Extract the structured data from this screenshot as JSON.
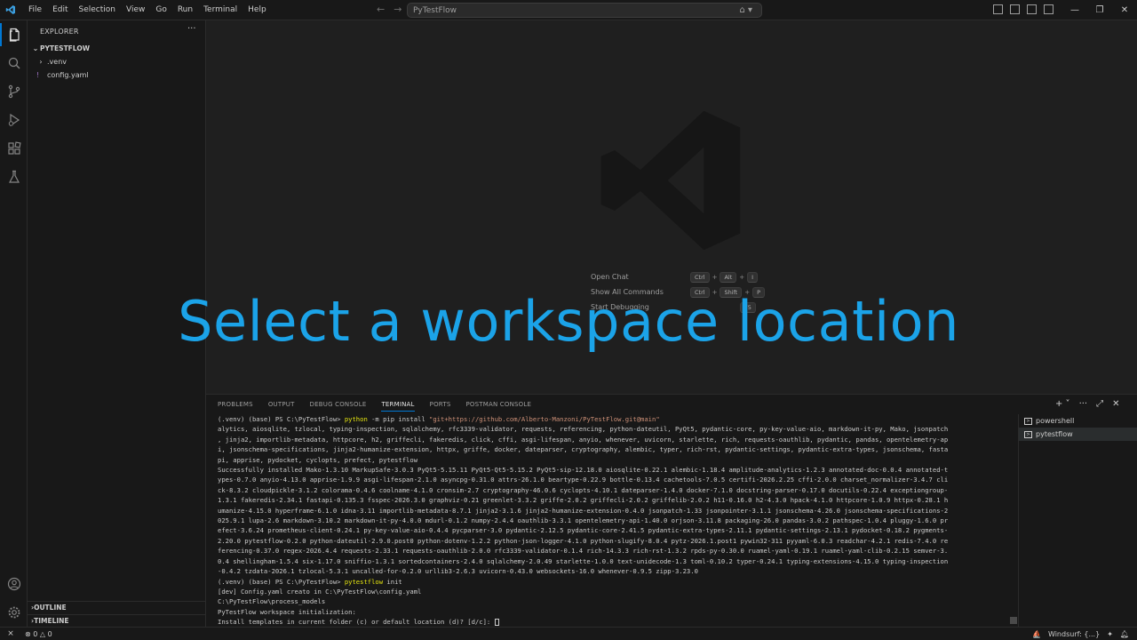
{
  "titlebar": {
    "menu": [
      "File",
      "Edit",
      "Selection",
      "View",
      "Go",
      "Run",
      "Terminal",
      "Help"
    ],
    "search_text": "PyTestFlow"
  },
  "sidebar": {
    "header": "EXPLORER",
    "root": "PYTESTFLOW",
    "items": [
      ".venv",
      "config.yaml"
    ],
    "outline": "OUTLINE",
    "timeline": "TIMELINE"
  },
  "editor": {
    "shortcuts": [
      {
        "label": "Open Chat",
        "keys": [
          "Ctrl",
          "Alt",
          "I"
        ]
      },
      {
        "label": "Show All Commands",
        "keys": [
          "Ctrl",
          "Shift",
          "P"
        ]
      },
      {
        "label": "Start Debugging",
        "keys": [
          "F5"
        ]
      }
    ]
  },
  "overlay_text": "Select a workspace location",
  "panel": {
    "tabs": [
      "PROBLEMS",
      "OUTPUT",
      "DEBUG CONSOLE",
      "TERMINAL",
      "PORTS",
      "POSTMAN CONSOLE"
    ],
    "active_tab": "TERMINAL",
    "terminal_instances": [
      "powershell",
      "pytestflow"
    ],
    "terminal_lines": [
      {
        "prompt": "(.venv) (base) PS C:\\PyTestFlow> ",
        "cmd": "python",
        "flag": " -m pip install ",
        "str": "\"git+https://github.com/Alberto-Manzoni/PyTestFlow.git@main\""
      },
      {
        "text": "alytics, aiosqlite, tzlocal, typing-inspection, sqlalchemy, rfc3339-validator, requests, referencing, python-dateutil, PyQt5, pydantic-core, py-key-value-aio, markdown-it-py, Mako, jsonpatch"
      },
      {
        "text": ", jinja2, importlib-metadata, httpcore, h2, griffecli, fakeredis, click, cffi, asgi-lifespan, anyio, whenever, uvicorn, starlette, rich, requests-oauthlib, pydantic, pandas, opentelemetry-ap"
      },
      {
        "text": "i, jsonschema-specifications, jinja2-humanize-extension, httpx, griffe, docker, dateparser, cryptography, alembic, typer, rich-rst, pydantic-settings, pydantic-extra-types, jsonschema, fasta"
      },
      {
        "text": "pi, apprise, pydocket, cyclopts, prefect, pytestflow"
      },
      {
        "text": "Successfully installed Mako-1.3.10 MarkupSafe-3.0.3 PyQt5-5.15.11 PyQt5-Qt5-5.15.2 PyQt5-sip-12.18.0 aiosqlite-0.22.1 alembic-1.18.4 amplitude-analytics-1.2.3 annotated-doc-0.0.4 annotated-t"
      },
      {
        "text": "ypes-0.7.0 anyio-4.13.0 apprise-1.9.9 asgi-lifespan-2.1.0 asyncpg-0.31.0 attrs-26.1.0 beartype-0.22.9 bottle-0.13.4 cachetools-7.0.5 certifi-2026.2.25 cffi-2.0.0 charset_normalizer-3.4.7 cli"
      },
      {
        "text": "ck-8.3.2 cloudpickle-3.1.2 colorama-0.4.6 coolname-4.1.0 cronsim-2.7 cryptography-46.0.6 cyclopts-4.10.1 dateparser-1.4.0 docker-7.1.0 docstring-parser-0.17.0 docutils-0.22.4 exceptiongroup-"
      },
      {
        "text": "1.3.1 fakeredis-2.34.1 fastapi-0.135.3 fsspec-2026.3.0 graphviz-0.21 greenlet-3.3.2 griffe-2.0.2 griffecli-2.0.2 griffelib-2.0.2 h11-0.16.0 h2-4.3.0 hpack-4.1.0 httpcore-1.0.9 httpx-0.28.1 h"
      },
      {
        "text": "umanize-4.15.0 hyperframe-6.1.0 idna-3.11 importlib-metadata-8.7.1 jinja2-3.1.6 jinja2-humanize-extension-0.4.0 jsonpatch-1.33 jsonpointer-3.1.1 jsonschema-4.26.0 jsonschema-specifications-2"
      },
      {
        "text": "025.9.1 lupa-2.6 markdown-3.10.2 markdown-it-py-4.0.0 mdurl-0.1.2 numpy-2.4.4 oauthlib-3.3.1 opentelemetry-api-1.40.0 orjson-3.11.8 packaging-26.0 pandas-3.0.2 pathspec-1.0.4 pluggy-1.6.0 pr"
      },
      {
        "text": "efect-3.6.24 prometheus-client-0.24.1 py-key-value-aio-0.4.4 pycparser-3.0 pydantic-2.12.5 pydantic-core-2.41.5 pydantic-extra-types-2.11.1 pydantic-settings-2.13.1 pydocket-0.18.2 pygments-"
      },
      {
        "text": "2.20.0 pytestflow-0.2.0 python-dateutil-2.9.0.post0 python-dotenv-1.2.2 python-json-logger-4.1.0 python-slugify-8.0.4 pytz-2026.1.post1 pywin32-311 pyyaml-6.0.3 readchar-4.2.1 redis-7.4.0 re"
      },
      {
        "text": "ferencing-0.37.0 regex-2026.4.4 requests-2.33.1 requests-oauthlib-2.0.0 rfc3339-validator-0.1.4 rich-14.3.3 rich-rst-1.3.2 rpds-py-0.30.0 ruamel-yaml-0.19.1 ruamel-yaml-clib-0.2.15 semver-3."
      },
      {
        "text": "0.4 shellingham-1.5.4 six-1.17.0 sniffio-1.3.1 sortedcontainers-2.4.0 sqlalchemy-2.0.49 starlette-1.0.0 text-unidecode-1.3 toml-0.10.2 typer-0.24.1 typing-extensions-4.15.0 typing-inspection"
      },
      {
        "text": "-0.4.2 tzdata-2026.1 tzlocal-5.3.1 uncalled-for-0.2.0 urllib3-2.6.3 uvicorn-0.43.0 websockets-16.0 whenever-0.9.5 zipp-3.23.0"
      },
      {
        "prompt": "(.venv) (base) PS C:\\PyTestFlow> ",
        "cmd": "pytestflow",
        "flag": " init",
        "str": ""
      },
      {
        "text": "[dev] Config.yaml creato in C:\\PyTestFlow\\config.yaml"
      },
      {
        "text": "C:\\PyTestFlow\\process_models"
      },
      {
        "text": "PyTestFlow workspace initialization:"
      },
      {
        "text": "Install templates in current folder (c) or default location (d)? [d/c]: "
      }
    ]
  },
  "statusbar": {
    "errors": "0",
    "warnings": "0",
    "windsurf": "Windsurf: {...}"
  },
  "colors": {
    "accent": "#0078d4",
    "overlay": "#1ba3e8",
    "background": "#1f1f1f"
  }
}
